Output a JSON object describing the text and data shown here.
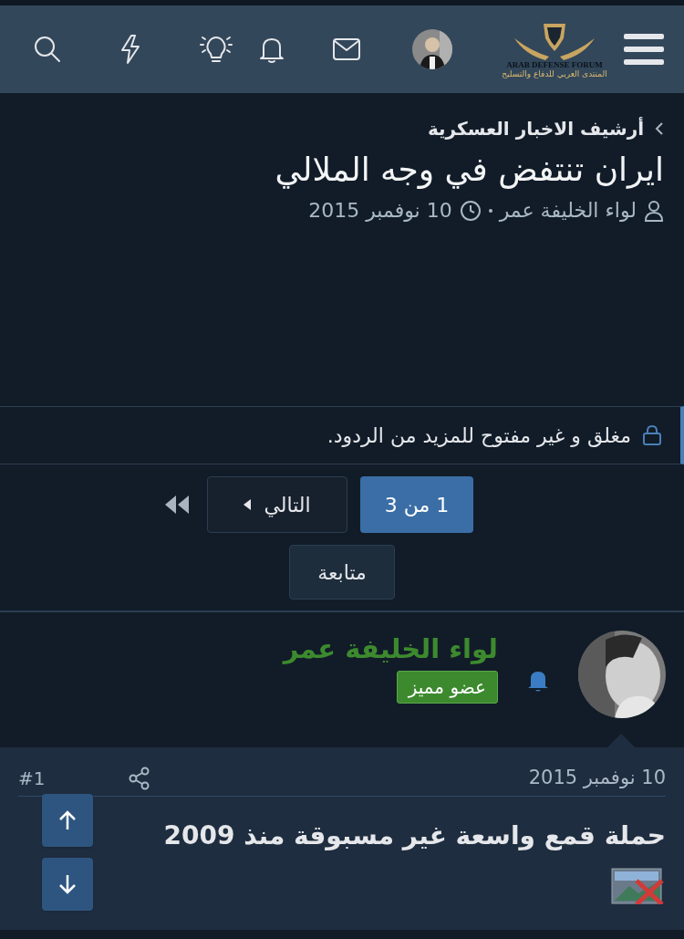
{
  "header": {
    "logo_text": "ARAB DEFENSE FORUM",
    "logo_subtext": "المنتدى العربي للدفاع والتسليح"
  },
  "breadcrumb": {
    "label": "أرشيف الاخبار العسكرية"
  },
  "thread": {
    "title": "ايران تنتفض في وجه الملالي",
    "author": "لواء الخليفة عمر",
    "date": "10 نوفمبر 2015"
  },
  "notice": {
    "text": "مغلق و غير مفتوح للمزيد من الردود."
  },
  "pagination": {
    "current": "1 من 3",
    "next": "التالي"
  },
  "follow_button": "متابعة",
  "post": {
    "author": "لواء الخليفة عمر",
    "badge": "عضو مميز",
    "date": "10 نوفمبر 2015",
    "number": "#1",
    "heading": "حملة قمع واسعة غير مسبوقة منذ 2009"
  }
}
